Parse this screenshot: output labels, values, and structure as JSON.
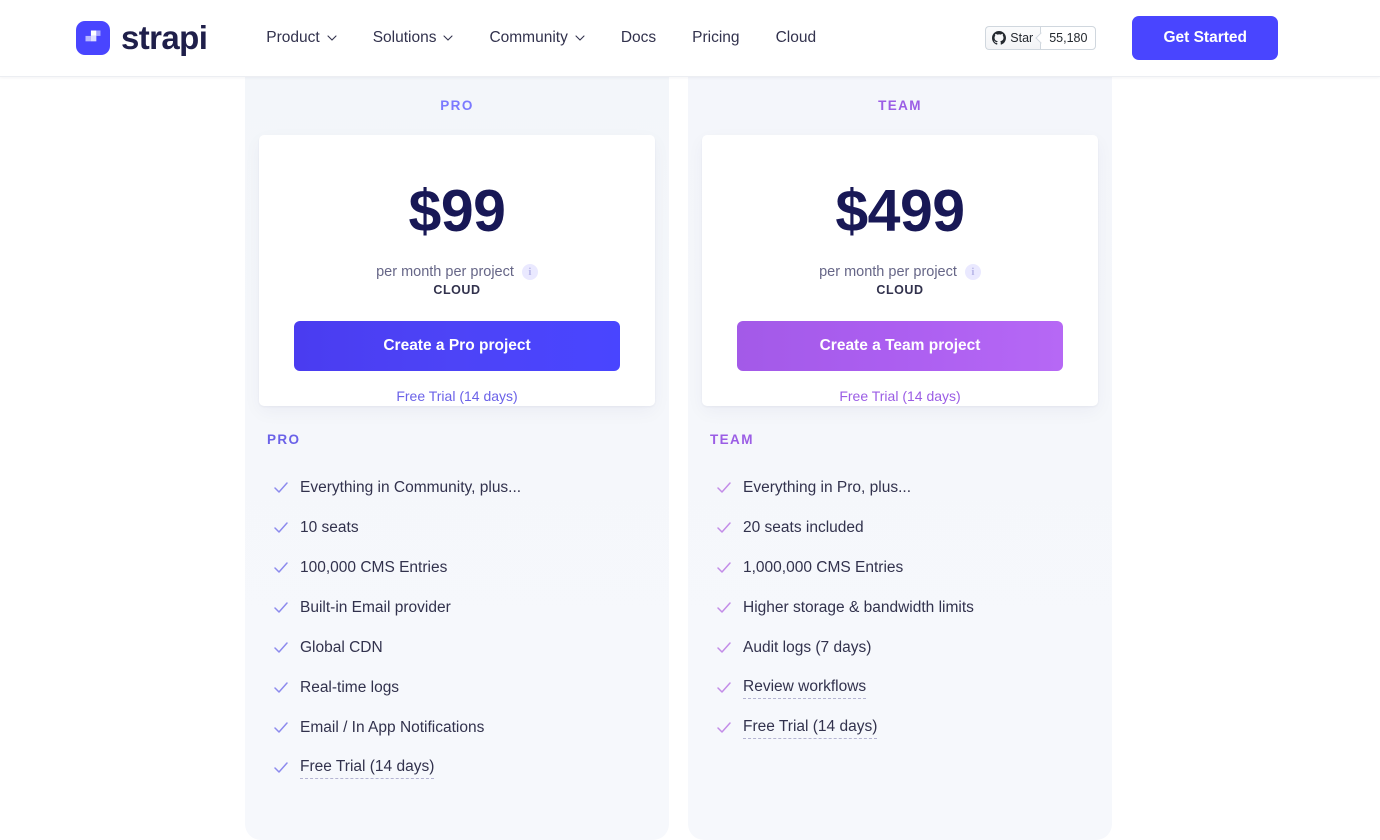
{
  "header": {
    "brand_name": "strapi",
    "logo_icon": "strapi-logo-icon",
    "nav": [
      {
        "label": "Product",
        "has_dropdown": true
      },
      {
        "label": "Solutions",
        "has_dropdown": true
      },
      {
        "label": "Community",
        "has_dropdown": true
      },
      {
        "label": "Docs",
        "has_dropdown": false
      },
      {
        "label": "Pricing",
        "has_dropdown": false
      },
      {
        "label": "Cloud",
        "has_dropdown": false
      }
    ],
    "github": {
      "icon": "github-icon",
      "star_label": "Star",
      "star_count": "55,180"
    },
    "cta_label": "Get Started",
    "accent_color": "#4945ff"
  },
  "pricing": {
    "plans": [
      {
        "id": "pro",
        "tier_label": "PRO",
        "tier_color": "#7b79ff",
        "price": "$99",
        "price_note": "per month per project",
        "info_icon": "info-icon",
        "plan_type": "CLOUD",
        "cta_label": "Create a Pro project",
        "cta_color": "#4945ff",
        "trial_label": "Free Trial (14 days)",
        "features_heading": "PRO",
        "features": [
          {
            "text": "Everything in Community, plus...",
            "dotted": false
          },
          {
            "text": "10 seats",
            "dotted": false
          },
          {
            "text": "100,000 CMS Entries",
            "dotted": false
          },
          {
            "text": "Built-in Email provider",
            "dotted": false
          },
          {
            "text": "Global CDN",
            "dotted": false
          },
          {
            "text": "Real-time logs",
            "dotted": false
          },
          {
            "text": "Email / In App Notifications",
            "dotted": false
          },
          {
            "text": "Free Trial (14 days)",
            "dotted": true
          }
        ],
        "check_color": "#8c8aee"
      },
      {
        "id": "team",
        "tier_label": "TEAM",
        "tier_color": "#9b5de5",
        "price": "$499",
        "price_note": "per month per project",
        "info_icon": "info-icon",
        "plan_type": "CLOUD",
        "cta_label": "Create a Team project",
        "cta_color": "#a855f7",
        "trial_label": "Free Trial (14 days)",
        "features_heading": "TEAM",
        "features": [
          {
            "text": "Everything in Pro, plus...",
            "dotted": false
          },
          {
            "text": "20 seats included",
            "dotted": false
          },
          {
            "text": "1,000,000 CMS Entries",
            "dotted": false
          },
          {
            "text": "Higher storage & bandwidth limits",
            "dotted": false
          },
          {
            "text": "Audit logs (7 days)",
            "dotted": false
          },
          {
            "text": "Review workflows",
            "dotted": true
          },
          {
            "text": "Free Trial (14 days)",
            "dotted": true
          }
        ],
        "check_color": "#c38ce8"
      }
    ]
  }
}
